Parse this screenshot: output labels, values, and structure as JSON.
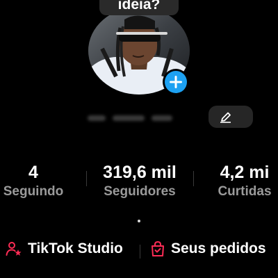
{
  "idea_bubble": {
    "text": "ideia?"
  },
  "profile": {
    "username_blurred": true
  },
  "stats": {
    "following": {
      "value": "4",
      "label": "Seguindo"
    },
    "followers": {
      "value": "319,6 mil",
      "label": "Seguidores"
    },
    "likes": {
      "value": "4,2 mi",
      "label": "Curtidas"
    }
  },
  "links": {
    "studio": {
      "label": "TikTok Studio",
      "icon": "person-star-icon"
    },
    "orders": {
      "label": "Seus pedidos",
      "icon": "shopping-bag-icon"
    }
  },
  "colors": {
    "background": "#000000",
    "accent_blue": "#1da1f2",
    "icon_red": "#fe2c55",
    "muted_text": "#9a9a9a"
  }
}
